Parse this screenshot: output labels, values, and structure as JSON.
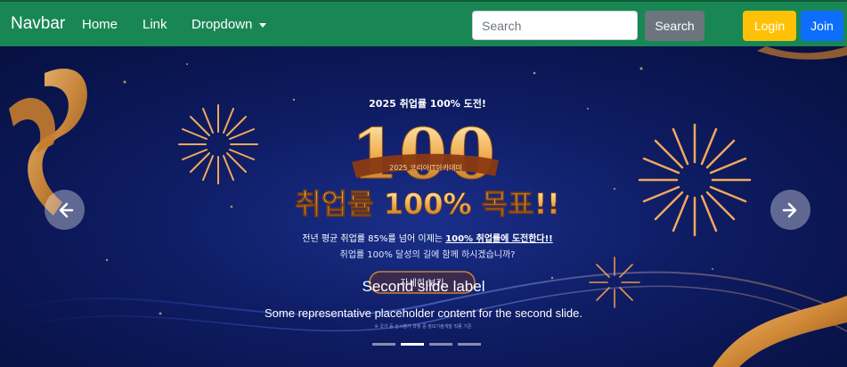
{
  "navbar": {
    "brand": "Navbar",
    "links": [
      "Home",
      "Link",
      "Dropdown"
    ],
    "search_placeholder": "Search",
    "search_button": "Search",
    "login_button": "Login",
    "join_button": "Join",
    "color": "#198754"
  },
  "carousel": {
    "banner": {
      "top_line": "2025 취업률 100% 도전!",
      "big_number": "100",
      "ribbon_text": "2025 코리아IT아카데미",
      "headline": "취업률 100% 목표!!",
      "line1_prefix": "전년 평균 취업률 85%를 넘어 이제는 ",
      "line1_emphasis": "100% 취업률에 도전한다!!",
      "line2": "취업률 100% 달성의 길에 함께 하시겠습니까?",
      "cta": "자세히 보기",
      "footnote": "※ 국가 등 상시평가 과정 중 정보기술개발 직종 기준"
    },
    "caption_title": "Second slide label",
    "caption_text": "Some representative placeholder content for the second slide.",
    "indicator_count": 4,
    "active_index": 1
  }
}
